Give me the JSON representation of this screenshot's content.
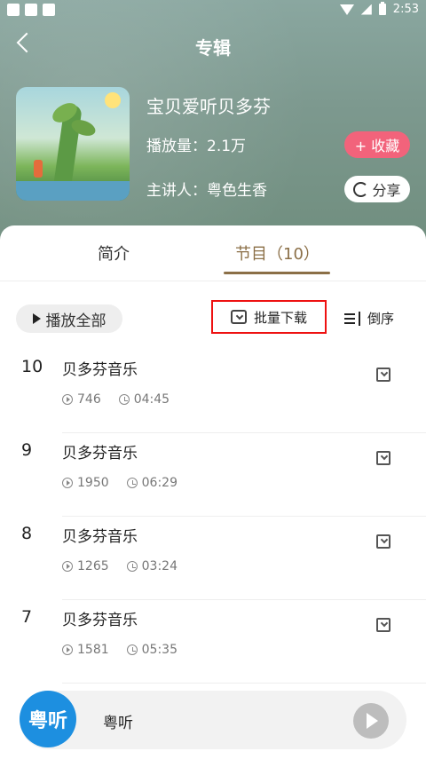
{
  "status_bar": {
    "time": "2:53"
  },
  "header": {
    "title": "专辑"
  },
  "album": {
    "title": "宝贝爱听贝多芬",
    "plays": "播放量：2.1万",
    "speaker": "主讲人：粤色生香",
    "favorite_label": "+ 收藏",
    "share_label": "分享"
  },
  "tabs": [
    {
      "label": "简介"
    },
    {
      "label": "节目（10）"
    }
  ],
  "toolbar": {
    "play_all": "播放全部",
    "batch_download": "批量下载",
    "sort": "倒序"
  },
  "episodes": [
    {
      "number": "10",
      "title": "贝多芬音乐",
      "plays": "746",
      "duration": "04:45"
    },
    {
      "number": "9",
      "title": "贝多芬音乐",
      "plays": "1950",
      "duration": "06:29"
    },
    {
      "number": "8",
      "title": "贝多芬音乐",
      "plays": "1265",
      "duration": "03:24"
    },
    {
      "number": "7",
      "title": "贝多芬音乐",
      "plays": "1581",
      "duration": "05:35"
    }
  ],
  "mini_player": {
    "logo_text": "粤听",
    "title": "粤听"
  },
  "colors": {
    "accent_brown": "#8b6f47",
    "favorite_pink": "#f2637b",
    "logo_blue": "#1d8fe0",
    "highlight_red": "#e11"
  }
}
